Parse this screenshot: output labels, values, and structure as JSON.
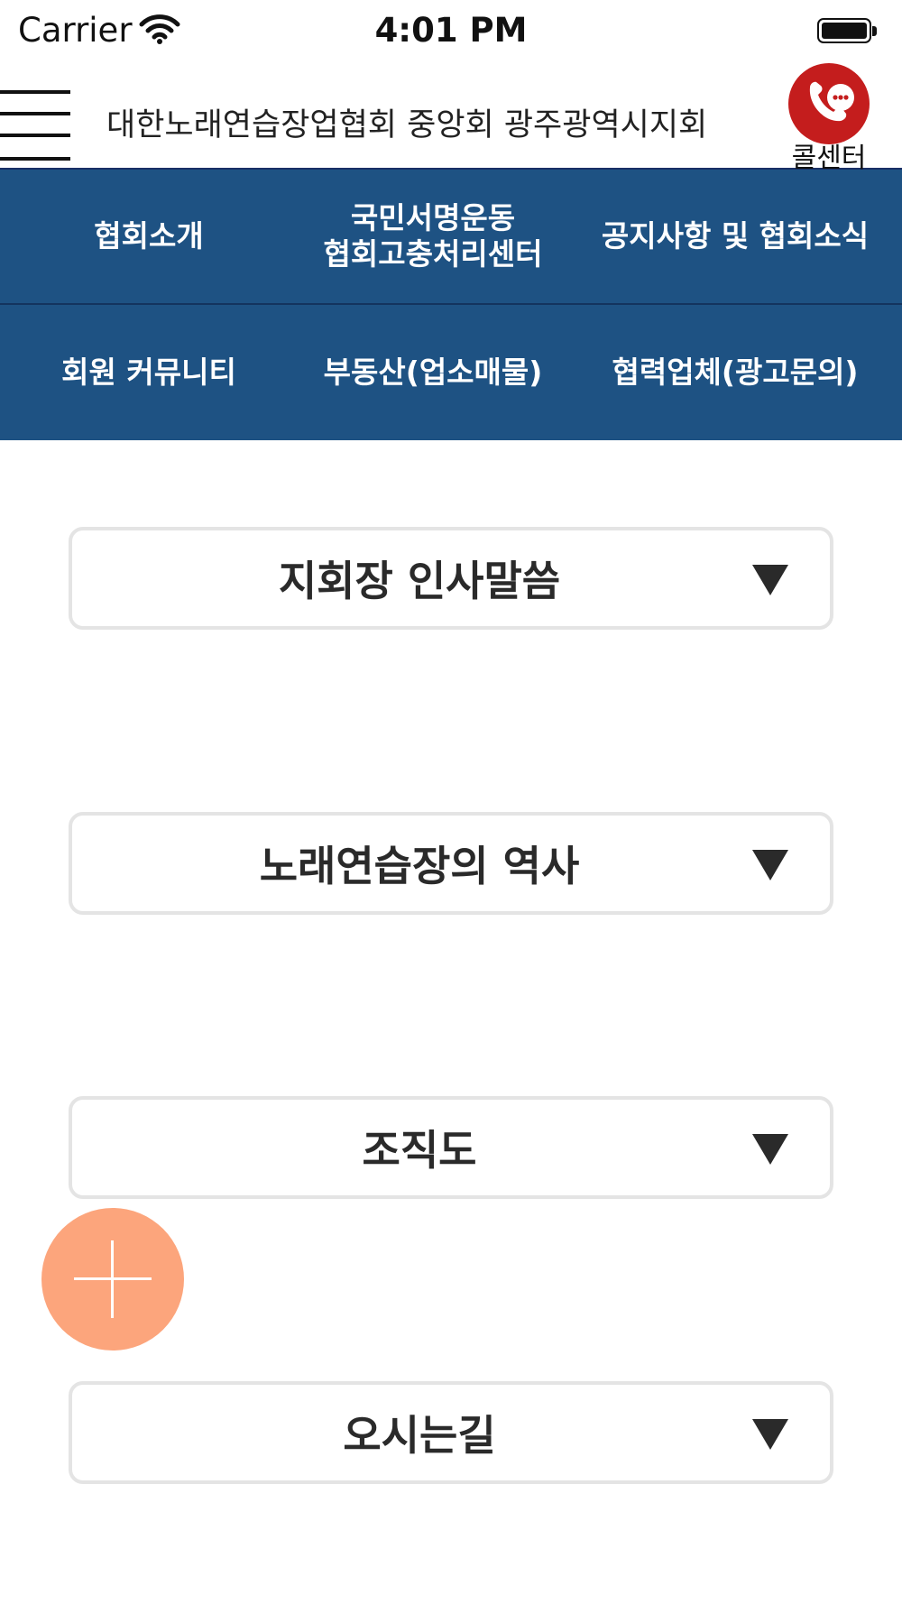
{
  "status_bar": {
    "carrier": "Carrier",
    "time": "4:01 PM"
  },
  "header": {
    "title": "대한노래연습장업협회 중앙회 광주광역시지회",
    "callcenter_label": "콜센터"
  },
  "nav": {
    "row1": {
      "intro": "협회소개",
      "campaign_line1": "국민서명운동",
      "campaign_line2": "협회고충처리센터",
      "notice": "공지사항 및 협회소식"
    },
    "row2": {
      "community": "회원 커뮤니티",
      "realestate": "부동산(업소매물)",
      "partners": "협력업체(광고문의)"
    }
  },
  "sections": {
    "greeting": "지회장 인사말씀",
    "history": "노래연습장의 역사",
    "organization": "조직도",
    "directions": "오시는길"
  },
  "colors": {
    "nav_bg": "#1e5283",
    "callcenter_red": "#c41d1d",
    "fab_orange": "#fca57c"
  }
}
